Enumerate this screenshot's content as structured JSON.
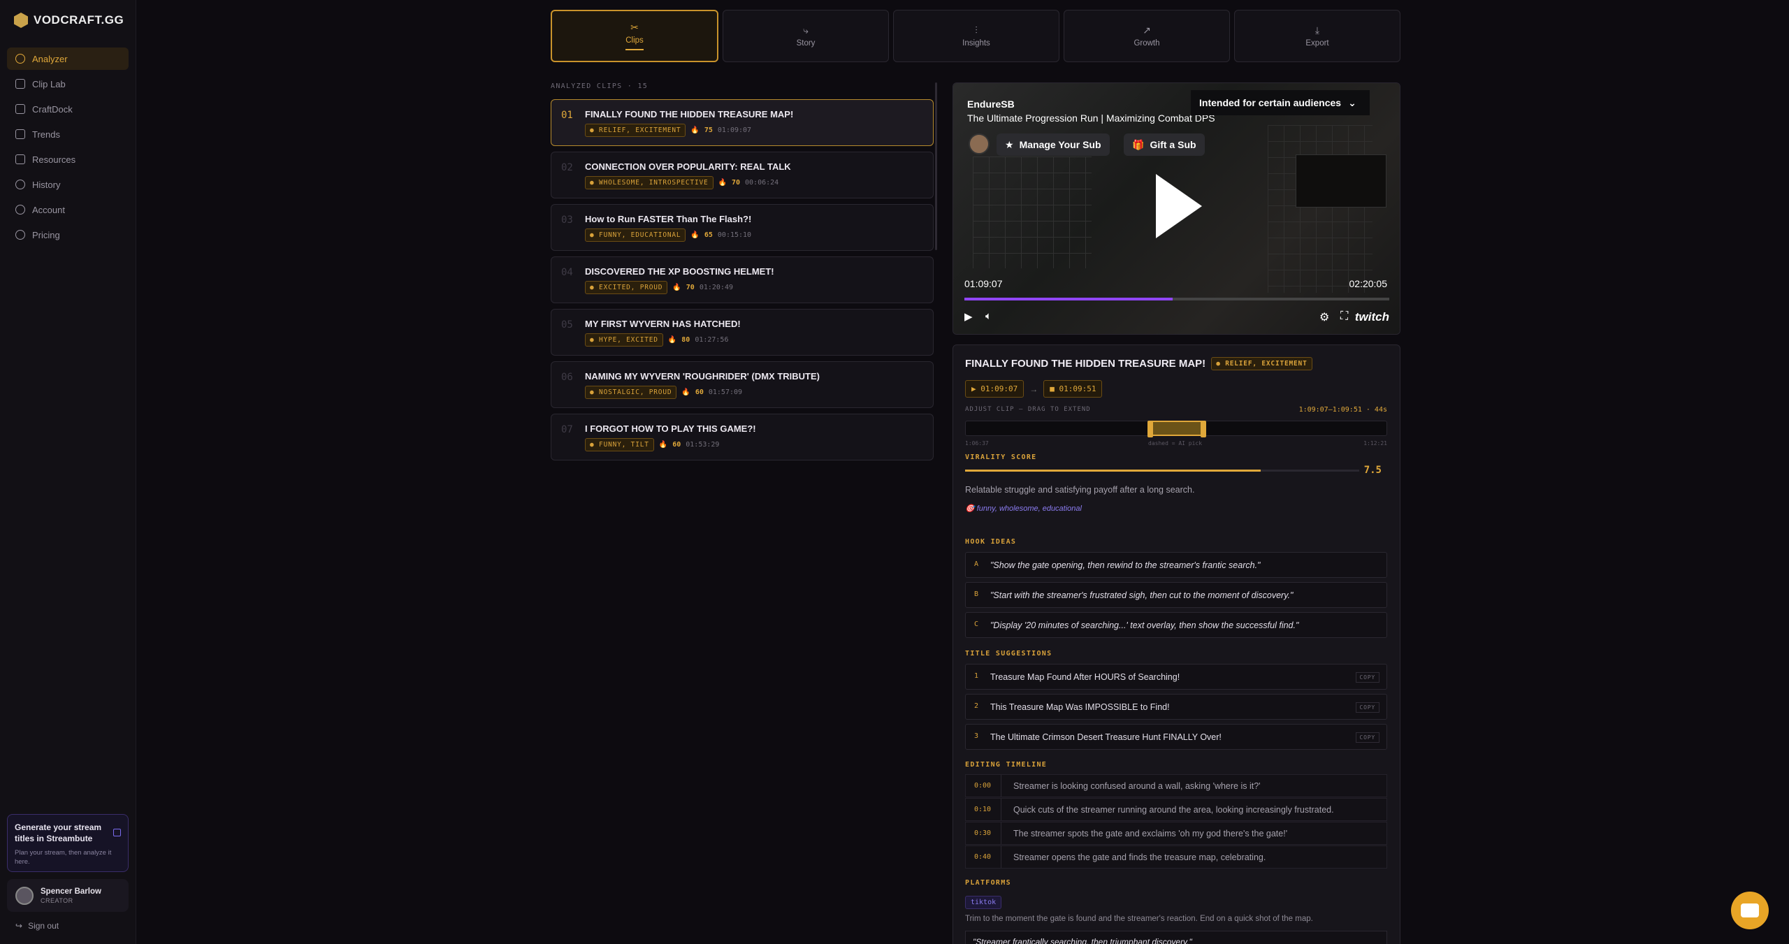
{
  "brand": {
    "name": "VODCRAFT.GG"
  },
  "sidebar": {
    "items": [
      {
        "label": "Analyzer"
      },
      {
        "label": "Clip Lab"
      },
      {
        "label": "CraftDock"
      },
      {
        "label": "Trends"
      },
      {
        "label": "Resources"
      },
      {
        "label": "History"
      },
      {
        "label": "Account"
      },
      {
        "label": "Pricing"
      }
    ],
    "promo": {
      "title": "Generate your stream titles in Streambute",
      "subtitle": "Plan your stream, then analyze it here."
    },
    "user": {
      "name": "Spencer Barlow",
      "role": "CREATOR"
    },
    "signout": "Sign out"
  },
  "tabs": [
    {
      "label": "Clips",
      "icon": "✂"
    },
    {
      "label": "Story",
      "icon": "⤷"
    },
    {
      "label": "Insights",
      "icon": "⫶"
    },
    {
      "label": "Growth",
      "icon": "↗"
    },
    {
      "label": "Export",
      "icon": "⤓"
    }
  ],
  "clips_header": "ANALYZED CLIPS · 15",
  "clips": [
    {
      "num": "01",
      "title": "FINALLY FOUND THE HIDDEN TREASURE MAP!",
      "tags": "RELIEF, EXCITEMENT",
      "score": "75",
      "time": "01:09:07"
    },
    {
      "num": "02",
      "title": "CONNECTION OVER POPULARITY: REAL TALK",
      "tags": "WHOLESOME, INTROSPECTIVE",
      "score": "70",
      "time": "00:06:24"
    },
    {
      "num": "03",
      "title": "How to Run FASTER Than The Flash?!",
      "tags": "FUNNY, EDUCATIONAL",
      "score": "65",
      "time": "00:15:10"
    },
    {
      "num": "04",
      "title": "DISCOVERED THE XP BOOSTING HELMET!",
      "tags": "EXCITED, PROUD",
      "score": "70",
      "time": "01:20:49"
    },
    {
      "num": "05",
      "title": "MY FIRST WYVERN HAS HATCHED!",
      "tags": "HYPE, EXCITED",
      "score": "80",
      "time": "01:27:56"
    },
    {
      "num": "06",
      "title": "NAMING MY WYVERN 'ROUGHRIDER' (DMX TRIBUTE)",
      "tags": "NOSTALGIC, PROUD",
      "score": "60",
      "time": "01:57:09"
    },
    {
      "num": "07",
      "title": "I FORGOT HOW TO PLAY THIS GAME?!",
      "tags": "FUNNY, TILT",
      "score": "60",
      "time": "01:53:29"
    }
  ],
  "video": {
    "channel": "EndureSB",
    "title": "The Ultimate Progression Run | Maximizing Combat DPS",
    "audience": "Intended for certain audiences",
    "manage_sub": "Manage Your Sub",
    "gift_sub": "Gift a Sub",
    "current_time": "01:09:07",
    "duration": "02:20:05",
    "progress": 0.49,
    "platform": "twitch"
  },
  "detail": {
    "title": "FINALLY FOUND THE HIDDEN TREASURE MAP!",
    "tags": "RELIEF, EXCITEMENT",
    "start": "01:09:07",
    "end": "01:09:51",
    "adjust_label": "ADJUST CLIP — DRAG TO EXTEND",
    "adjust_range": "1:09:07–1:09:51 · 44s",
    "trim_ticks": [
      "1:06:37",
      "dashed = AI pick",
      "1:12:21"
    ],
    "virality_label": "VIRALITY SCORE",
    "virality_score": "7.5",
    "virality_fraction": 0.75,
    "description": "Relatable struggle and satisfying payoff after a long search.",
    "topic_tags": "🎯 funny, wholesome, educational",
    "hook_label": "HOOK IDEAS",
    "hooks": [
      {
        "key": "A",
        "text": "\"Show the gate opening, then rewind to the streamer's frantic search.\""
      },
      {
        "key": "B",
        "text": "\"Start with the streamer's frustrated sigh, then cut to the moment of discovery.\""
      },
      {
        "key": "C",
        "text": "\"Display '20 minutes of searching...' text overlay, then show the successful find.\""
      }
    ],
    "titles_label": "TITLE SUGGESTIONS",
    "titles": [
      {
        "key": "1",
        "text": "Treasure Map Found After HOURS of Searching!",
        "copy": "COPY"
      },
      {
        "key": "2",
        "text": "This Treasure Map Was IMPOSSIBLE to Find!",
        "copy": "COPY"
      },
      {
        "key": "3",
        "text": "The Ultimate Crimson Desert Treasure Hunt FINALLY Over!",
        "copy": "COPY"
      }
    ],
    "timeline_label": "EDITING TIMELINE",
    "timeline": [
      {
        "time": "0:00",
        "text": "Streamer is looking confused around a wall, asking 'where is it?'"
      },
      {
        "time": "0:10",
        "text": "Quick cuts of the streamer running around the area, looking increasingly frustrated."
      },
      {
        "time": "0:30",
        "text": "The streamer spots the gate and exclaims 'oh my god there's the gate!'"
      },
      {
        "time": "0:40",
        "text": "Streamer opens the gate and finds the treasure map, celebrating."
      }
    ],
    "platforms_label": "PLATFORMS",
    "platform": "tiktok",
    "platform_note": "Trim to the moment the gate is found and the streamer's reaction. End on a quick shot of the map.",
    "caption": "\"Streamer frantically searching, then triumphant discovery.\""
  },
  "colors": {
    "accent": "#e0a83a",
    "purple": "#8b7cf0",
    "bg": "#0d0b10"
  }
}
